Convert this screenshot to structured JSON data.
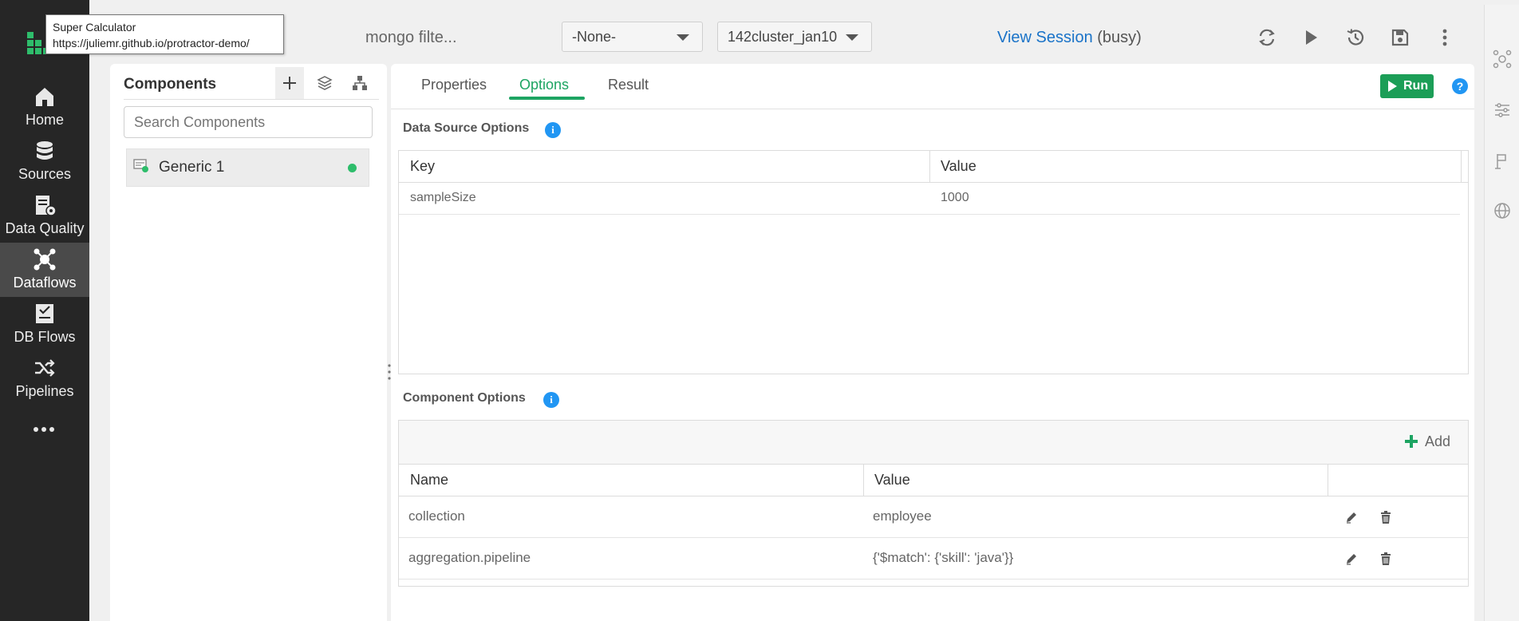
{
  "tooltip": {
    "title": "Super Calculator",
    "url": "https://juliemr.github.io/protractor-demo/"
  },
  "nav": {
    "items": [
      {
        "label": "Home",
        "icon": "home-icon"
      },
      {
        "label": "Sources",
        "icon": "database-icon"
      },
      {
        "label": "Data Quality",
        "icon": "data-quality-icon"
      },
      {
        "label": "Dataflows",
        "icon": "dataflows-icon",
        "active": true
      },
      {
        "label": "DB Flows",
        "icon": "db-flows-icon"
      },
      {
        "label": "Pipelines",
        "icon": "pipelines-icon"
      }
    ],
    "more": "more-icon"
  },
  "topbar": {
    "flow_name": "mongo filte...",
    "select_1": "-None-",
    "select_2": "142cluster_jan10",
    "session_link": "View Session",
    "session_status": "(busy)"
  },
  "components": {
    "title": "Components",
    "search_placeholder": "Search Components",
    "items": [
      {
        "label": "Generic 1",
        "status_color": "#2ebd6b"
      }
    ]
  },
  "tabs": {
    "items": [
      "Properties",
      "Options",
      "Result"
    ],
    "active": "Options"
  },
  "run_label": "Run",
  "help_label": "?",
  "data_source_options": {
    "title": "Data Source Options",
    "info": "i",
    "columns": [
      "Key",
      "Value"
    ],
    "rows": [
      {
        "key": "sampleSize",
        "value": "1000"
      }
    ]
  },
  "component_options": {
    "title": "Component Options",
    "info": "i",
    "add_label": "Add",
    "columns": [
      "Name",
      "Value"
    ],
    "rows": [
      {
        "name": "collection",
        "value": "employee"
      },
      {
        "name": "aggregation.pipeline",
        "value": "{'$match': {'skill': 'java'}}"
      }
    ]
  },
  "colors": {
    "accent": "#1da462",
    "nav_bg": "#262626",
    "info": "#2196f3",
    "link": "#1a73c8"
  }
}
